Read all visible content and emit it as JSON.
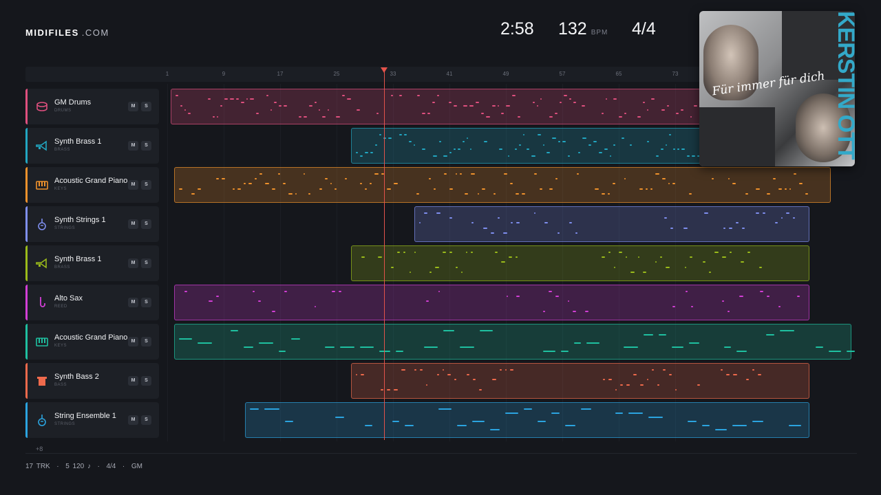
{
  "brand": {
    "name": "MIDIFILES",
    "suffix": ".COM"
  },
  "header": {
    "duration": "2:58",
    "tempo": "132",
    "tempo_unit": "BPM",
    "time_signature": "4/4"
  },
  "ruler": {
    "bars": [
      "1",
      "9",
      "17",
      "25",
      "33",
      "41",
      "49",
      "57",
      "65",
      "73"
    ]
  },
  "playhead_bar": 32,
  "tracks": [
    {
      "name": "GM Drums",
      "category": "DRUMS",
      "icon": "drum-icon",
      "color": "#e0507f",
      "mute": "M",
      "solo": "S"
    },
    {
      "name": "Synth Brass 1",
      "category": "BRASS",
      "icon": "trumpet-icon",
      "color": "#22a7c2",
      "mute": "M",
      "solo": "S"
    },
    {
      "name": "Acoustic Grand Piano",
      "category": "KEYS",
      "icon": "piano-icon",
      "color": "#f0922c",
      "mute": "M",
      "solo": "S"
    },
    {
      "name": "Synth Strings 1",
      "category": "STRINGS",
      "icon": "violin-icon",
      "color": "#7f8ff0",
      "mute": "M",
      "solo": "S"
    },
    {
      "name": "Synth Brass 1",
      "category": "BRASS",
      "icon": "trumpet-icon",
      "color": "#9bbc1a",
      "mute": "M",
      "solo": "S"
    },
    {
      "name": "Alto Sax",
      "category": "REED",
      "icon": "sax-icon",
      "color": "#d23fd6",
      "mute": "M",
      "solo": "S"
    },
    {
      "name": "Acoustic Grand Piano",
      "category": "KEYS",
      "icon": "piano-icon",
      "color": "#1fc0a0",
      "mute": "M",
      "solo": "S"
    },
    {
      "name": "Synth Bass 2",
      "category": "BASS",
      "icon": "bass-icon",
      "color": "#ef6a4c",
      "mute": "M",
      "solo": "S"
    },
    {
      "name": "String Ensemble 1",
      "category": "STRINGS",
      "icon": "violin-icon",
      "color": "#2ba4e0",
      "mute": "M",
      "solo": "S"
    }
  ],
  "more_tracks": "+8",
  "footer": {
    "tracks": "17 TRK",
    "notes": "5 120 ♪",
    "time_signature": "4/4",
    "standard": "GM"
  },
  "album": {
    "artist": "KERSTIN OTT",
    "title": "Für immer für dich"
  }
}
